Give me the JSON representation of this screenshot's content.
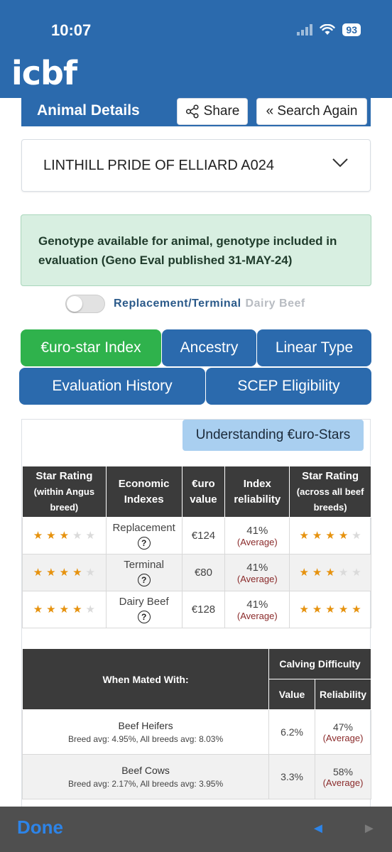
{
  "status_bar": {
    "time": "10:07",
    "battery": "93"
  },
  "app": {
    "logo": "icbf"
  },
  "header": {
    "title": "Animal Details",
    "share_label": "Share",
    "search_again_label": "« Search Again"
  },
  "animal": {
    "name": "LINTHILL PRIDE OF ELLIARD A024"
  },
  "genotype_notice": "Genotype available for animal, genotype included in evaluation (Geno Eval published 31-MAY-24)",
  "toggle": {
    "on_label": "Replacement/Terminal",
    "off_label": "Dairy Beef"
  },
  "tabs": [
    {
      "label": "€uro-star Index",
      "active": true
    },
    {
      "label": "Ancestry",
      "active": false
    },
    {
      "label": "Linear Type",
      "active": false
    },
    {
      "label": "Evaluation History",
      "active": false
    },
    {
      "label": "SCEP Eligibility",
      "active": false
    }
  ],
  "understanding_button": "Understanding €uro-Stars",
  "star_table": {
    "headers": {
      "breed_rating": "Star Rating",
      "breed_rating_sub": "(within Angus breed)",
      "economic": "Economic Indexes",
      "euro": "€uro value",
      "reliability": "Index reliability",
      "all_rating": "Star Rating",
      "all_rating_sub": "(across all beef breeds)"
    },
    "rows": [
      {
        "index": "Replacement",
        "breed_stars": 3,
        "euro": "€124",
        "reliability": "41%",
        "reliability_note": "(Average)",
        "all_stars": 4
      },
      {
        "index": "Terminal",
        "breed_stars": 4,
        "euro": "€80",
        "reliability": "41%",
        "reliability_note": "(Average)",
        "all_stars": 3
      },
      {
        "index": "Dairy Beef",
        "breed_stars": 4,
        "euro": "€128",
        "reliability": "41%",
        "reliability_note": "(Average)",
        "all_stars": 5
      }
    ],
    "max_stars": 5
  },
  "calving_table": {
    "headers": {
      "mated_with": "When Mated With:",
      "group": "Calving Difficulty",
      "value": "Value",
      "reliability": "Reliability"
    },
    "rows": [
      {
        "name": "Beef Heifers",
        "sub": "Breed avg: 4.95%, All breeds avg: 8.03%",
        "value": "6.2%",
        "reliability": "47%",
        "reliability_note": "(Average)"
      },
      {
        "name": "Beef Cows",
        "sub": "Breed avg: 2.17%, All breeds avg: 3.95%",
        "value": "3.3%",
        "reliability": "58%",
        "reliability_note": "(Average)"
      }
    ]
  },
  "bottom_bar": {
    "done_label": "Done",
    "prev_icon": "◄",
    "next_icon": "►"
  },
  "colors": {
    "brand_blue": "#2b6aad",
    "active_green": "#2fb24c",
    "star": "#e6920e",
    "done_blue": "#2d84e8"
  }
}
